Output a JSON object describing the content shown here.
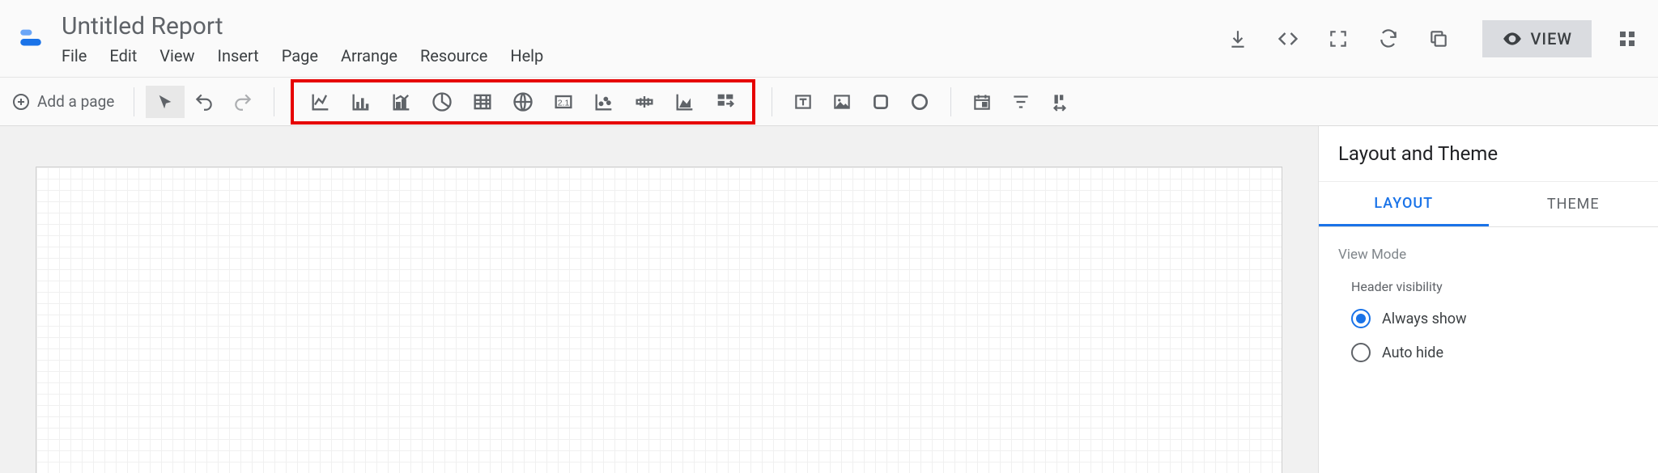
{
  "header": {
    "title": "Untitled Report",
    "menu": [
      "File",
      "Edit",
      "View",
      "Insert",
      "Page",
      "Arrange",
      "Resource",
      "Help"
    ],
    "view_button": "VIEW"
  },
  "toolbar": {
    "add_page": "Add a page"
  },
  "side_panel": {
    "title": "Layout and Theme",
    "tabs": {
      "layout": "LAYOUT",
      "theme": "THEME"
    },
    "view_mode": "View Mode",
    "header_visibility": "Header visibility",
    "options": {
      "always_show": "Always show",
      "auto_hide": "Auto hide"
    }
  }
}
